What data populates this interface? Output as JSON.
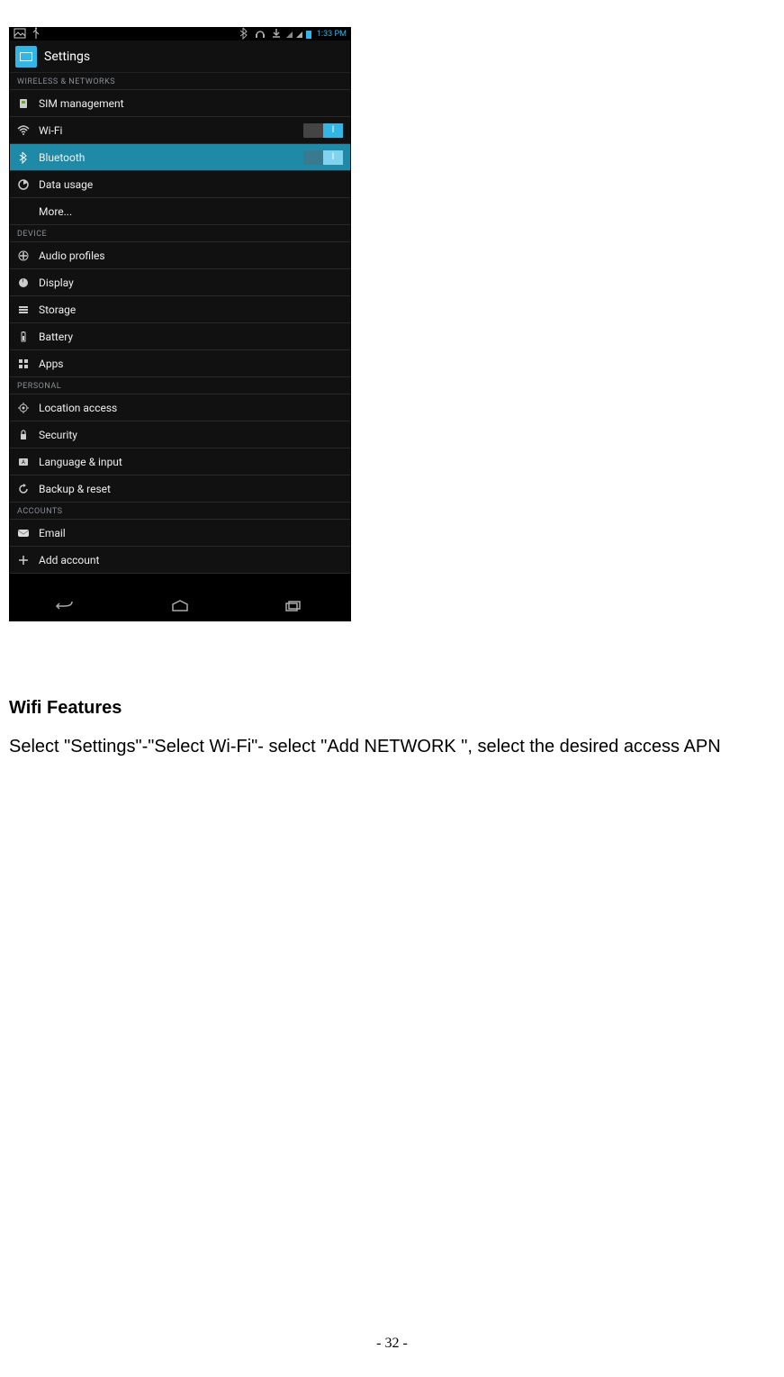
{
  "statusbar": {
    "time": "1:33 PM"
  },
  "app": {
    "title": "Settings"
  },
  "sections": {
    "wireless_header": "WIRELESS & NETWORKS",
    "device_header": "DEVICE",
    "personal_header": "PERSONAL",
    "accounts_header": "ACCOUNTS"
  },
  "rows": {
    "sim": "SIM management",
    "wifi": "Wi-Fi",
    "bluetooth": "Bluetooth",
    "data": "Data usage",
    "more": "More...",
    "audio": "Audio profiles",
    "display": "Display",
    "storage": "Storage",
    "battery": "Battery",
    "apps": "Apps",
    "location": "Location access",
    "security": "Security",
    "language": "Language & input",
    "backup": "Backup & reset",
    "email": "Email",
    "add_account": "Add account"
  },
  "doc": {
    "heading": "Wifi Features",
    "paragraph": "Select \"Settings\"-\"Select Wi-Fi\"- select \"Add NETWORK \", select the desired access APN",
    "page_number": "- 32 -"
  }
}
